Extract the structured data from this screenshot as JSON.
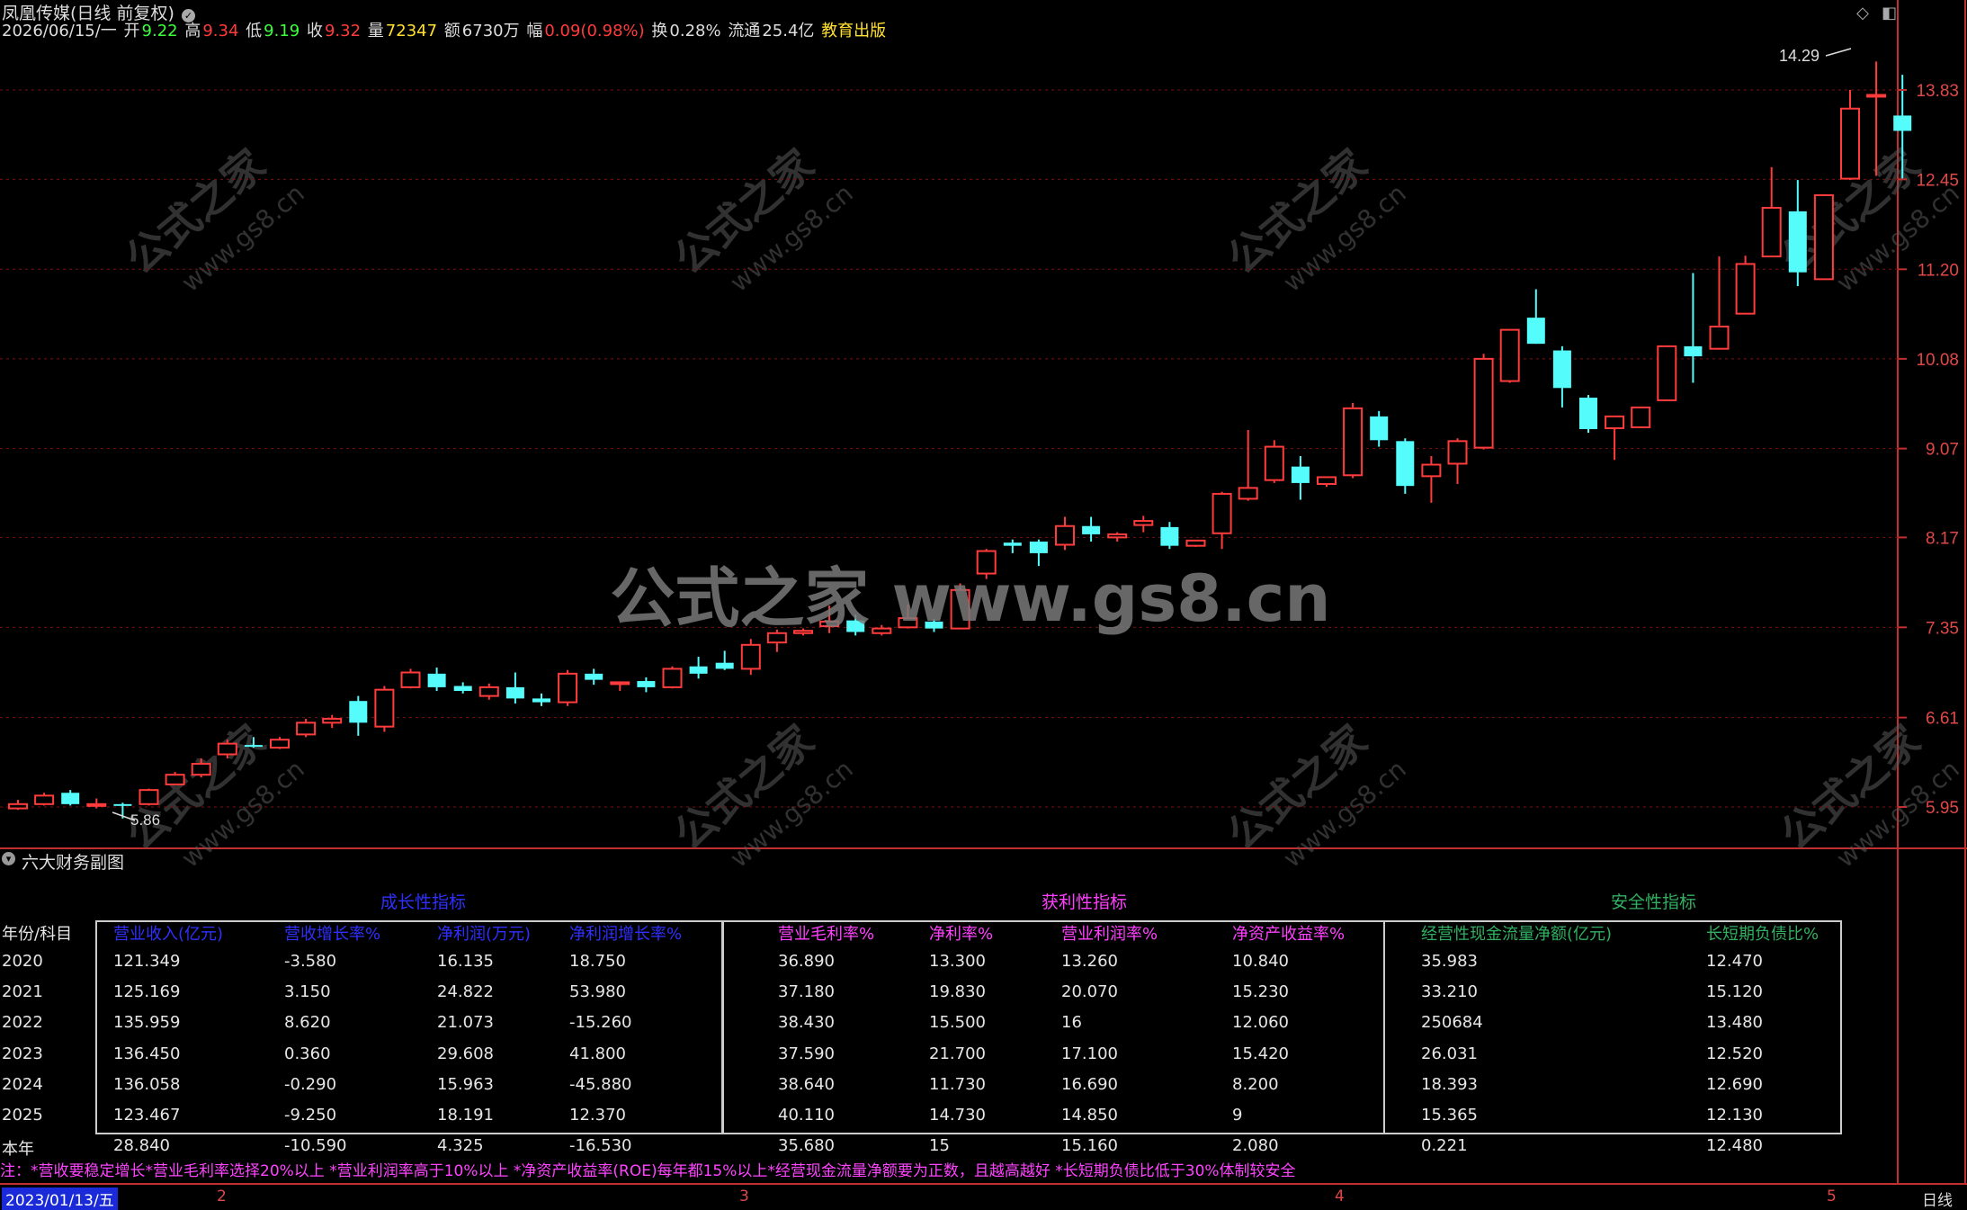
{
  "header": {
    "stock_name": "凤凰传媒(日线 前复权)",
    "date": "2026/06/15/一",
    "open_label": "开",
    "open": "9.22",
    "high_label": "高",
    "high": "9.34",
    "low_label": "低",
    "low": "9.19",
    "close_label": "收",
    "close": "9.32",
    "volume_label": "量",
    "volume": "72347",
    "amount_label": "额",
    "amount": "6730万",
    "change_label": "幅",
    "change": "0.09(0.98%)",
    "turnover_label": "换",
    "turnover": "0.28%",
    "float_label": "流通",
    "float_cap": "25.4亿",
    "tag": "教育出版"
  },
  "price_axis": [
    "13.83",
    "12.45",
    "11.20",
    "10.08",
    "9.07",
    "8.17",
    "7.35",
    "6.61",
    "5.95"
  ],
  "markers": {
    "high_marker": "14.29",
    "low_marker": "5.86"
  },
  "watermark": {
    "big": "公式之家 www.gs8.cn",
    "small_cn": "公式之家",
    "small_url": "www.gs8.cn"
  },
  "colors": {
    "up": "#ff3b3b",
    "down": "#54fcfc",
    "axis": "#c03030",
    "grid": "#7a1010"
  },
  "candles": [
    [
      5.94,
      6.0,
      5.93,
      5.97
    ],
    [
      5.97,
      6.05,
      5.96,
      6.03
    ],
    [
      6.05,
      6.07,
      5.96,
      5.97
    ],
    [
      5.97,
      6.01,
      5.94,
      5.97
    ],
    [
      5.97,
      5.98,
      5.87,
      5.96
    ],
    [
      5.97,
      6.08,
      5.96,
      6.07
    ],
    [
      6.11,
      6.2,
      6.11,
      6.18
    ],
    [
      6.18,
      6.3,
      6.16,
      6.26
    ],
    [
      6.33,
      6.44,
      6.3,
      6.41
    ],
    [
      6.4,
      6.46,
      6.38,
      6.39
    ],
    [
      6.38,
      6.46,
      6.37,
      6.44
    ],
    [
      6.48,
      6.6,
      6.46,
      6.57
    ],
    [
      6.57,
      6.63,
      6.53,
      6.6
    ],
    [
      6.74,
      6.78,
      6.47,
      6.57
    ],
    [
      6.54,
      6.86,
      6.5,
      6.83
    ],
    [
      6.85,
      7.0,
      6.84,
      6.97
    ],
    [
      6.96,
      7.01,
      6.82,
      6.85
    ],
    [
      6.86,
      6.89,
      6.8,
      6.82
    ],
    [
      6.78,
      6.88,
      6.75,
      6.85
    ],
    [
      6.85,
      6.97,
      6.72,
      6.76
    ],
    [
      6.76,
      6.8,
      6.7,
      6.73
    ],
    [
      6.73,
      6.99,
      6.7,
      6.96
    ],
    [
      6.96,
      7.0,
      6.87,
      6.91
    ],
    [
      6.89,
      6.89,
      6.82,
      6.89
    ],
    [
      6.9,
      6.93,
      6.81,
      6.85
    ],
    [
      6.85,
      7.02,
      6.84,
      7.0
    ],
    [
      7.02,
      7.1,
      6.92,
      6.96
    ],
    [
      7.05,
      7.15,
      6.99,
      7.0
    ],
    [
      7.0,
      7.25,
      6.95,
      7.2
    ],
    [
      7.22,
      7.33,
      7.14,
      7.3
    ],
    [
      7.3,
      7.34,
      7.28,
      7.32
    ],
    [
      7.36,
      7.54,
      7.3,
      7.4
    ],
    [
      7.41,
      7.46,
      7.28,
      7.31
    ],
    [
      7.3,
      7.37,
      7.28,
      7.34
    ],
    [
      7.35,
      7.55,
      7.34,
      7.43
    ],
    [
      7.4,
      7.42,
      7.31,
      7.34
    ],
    [
      7.34,
      7.74,
      7.34,
      7.68
    ],
    [
      7.83,
      8.06,
      7.78,
      8.04
    ],
    [
      8.12,
      8.15,
      8.02,
      8.09
    ],
    [
      8.13,
      8.15,
      7.9,
      8.02
    ],
    [
      8.1,
      8.37,
      8.05,
      8.28
    ],
    [
      8.28,
      8.37,
      8.13,
      8.2
    ],
    [
      8.17,
      8.22,
      8.13,
      8.2
    ],
    [
      8.29,
      8.38,
      8.22,
      8.33
    ],
    [
      8.27,
      8.32,
      8.06,
      8.09
    ],
    [
      8.09,
      8.14,
      8.08,
      8.14
    ],
    [
      8.21,
      8.62,
      8.06,
      8.6
    ],
    [
      8.55,
      9.27,
      8.53,
      8.66
    ],
    [
      8.74,
      9.16,
      8.71,
      9.09
    ],
    [
      8.88,
      8.99,
      8.54,
      8.71
    ],
    [
      8.7,
      8.77,
      8.67,
      8.77
    ],
    [
      8.79,
      9.57,
      8.76,
      9.51
    ],
    [
      9.42,
      9.48,
      9.09,
      9.16
    ],
    [
      9.15,
      9.18,
      8.6,
      8.68
    ],
    [
      8.78,
      8.99,
      8.51,
      8.9
    ],
    [
      8.91,
      9.18,
      8.7,
      9.15
    ],
    [
      9.08,
      10.14,
      9.06,
      10.08
    ],
    [
      9.82,
      10.42,
      9.8,
      10.43
    ],
    [
      10.58,
      10.94,
      10.26,
      10.26
    ],
    [
      10.18,
      10.23,
      9.52,
      9.74
    ],
    [
      9.63,
      9.66,
      9.24,
      9.28
    ],
    [
      9.29,
      9.41,
      8.95,
      9.42
    ],
    [
      9.3,
      9.52,
      9.3,
      9.52
    ],
    [
      9.6,
      10.23,
      9.6,
      10.23
    ],
    [
      10.23,
      11.15,
      9.8,
      10.11
    ],
    [
      10.2,
      11.37,
      10.19,
      10.47
    ],
    [
      10.63,
      11.38,
      10.62,
      11.27
    ],
    [
      11.37,
      12.63,
      11.36,
      12.04
    ],
    [
      11.99,
      12.44,
      10.98,
      11.16
    ],
    [
      11.07,
      12.17,
      11.07,
      12.22
    ],
    [
      12.46,
      13.83,
      12.44,
      13.53
    ],
    [
      13.73,
      14.3,
      12.5,
      13.75
    ],
    [
      13.42,
      14.08,
      12.45,
      13.18
    ]
  ],
  "fin_panel": {
    "title": "六大财务副图",
    "groups": {
      "growth": "成长性指标",
      "profit": "获利性指标",
      "safety": "安全性指标"
    },
    "row_header": "年份/科目",
    "headers": [
      "营业收入(亿元)",
      "营收增长率%",
      "净利润(万元)",
      "净利润增长率%",
      "营业毛利率%",
      "净利率%",
      "营业利润率%",
      "净资产收益率%",
      "经营性现金流量净额(亿元)",
      "长短期负债比%"
    ],
    "rows": [
      {
        "year": "2020",
        "v": [
          "121.349",
          "-3.580",
          "16.135",
          "18.750",
          "36.890",
          "13.300",
          "13.260",
          "10.840",
          "35.983",
          "12.470"
        ]
      },
      {
        "year": "2021",
        "v": [
          "125.169",
          "3.150",
          "24.822",
          "53.980",
          "37.180",
          "19.830",
          "20.070",
          "15.230",
          "33.210",
          "15.120"
        ]
      },
      {
        "year": "2022",
        "v": [
          "135.959",
          "8.620",
          "21.073",
          "-15.260",
          "38.430",
          "15.500",
          "16",
          "12.060",
          "250684",
          "13.480"
        ]
      },
      {
        "year": "2023",
        "v": [
          "136.450",
          "0.360",
          "29.608",
          "41.800",
          "37.590",
          "21.700",
          "17.100",
          "15.420",
          "26.031",
          "12.520"
        ]
      },
      {
        "year": "2024",
        "v": [
          "136.058",
          "-0.290",
          "15.963",
          "-45.880",
          "38.640",
          "11.730",
          "16.690",
          "8.200",
          "18.393",
          "12.690"
        ]
      },
      {
        "year": "2025",
        "v": [
          "123.467",
          "-9.250",
          "18.191",
          "12.370",
          "40.110",
          "14.730",
          "14.850",
          "9",
          "15.365",
          "12.130"
        ]
      },
      {
        "year": "本年",
        "v": [
          "28.840",
          "-10.590",
          "4.325",
          "-16.530",
          "35.680",
          "15",
          "15.160",
          "2.080",
          "0.221",
          "12.480"
        ]
      }
    ]
  },
  "note": "注：*营收要稳定增长*营业毛利率选择20%以上 *营业利润率高于10%以上 *净资产收益率(ROE)每年都15%以上*经营现金流量净额要为正数，且越高越好 *长短期负债比低于30%体制较安全",
  "bottom": {
    "date": "2023/01/13/五",
    "ticks": [
      "2",
      "3",
      "4",
      "5"
    ],
    "period": "日线"
  }
}
